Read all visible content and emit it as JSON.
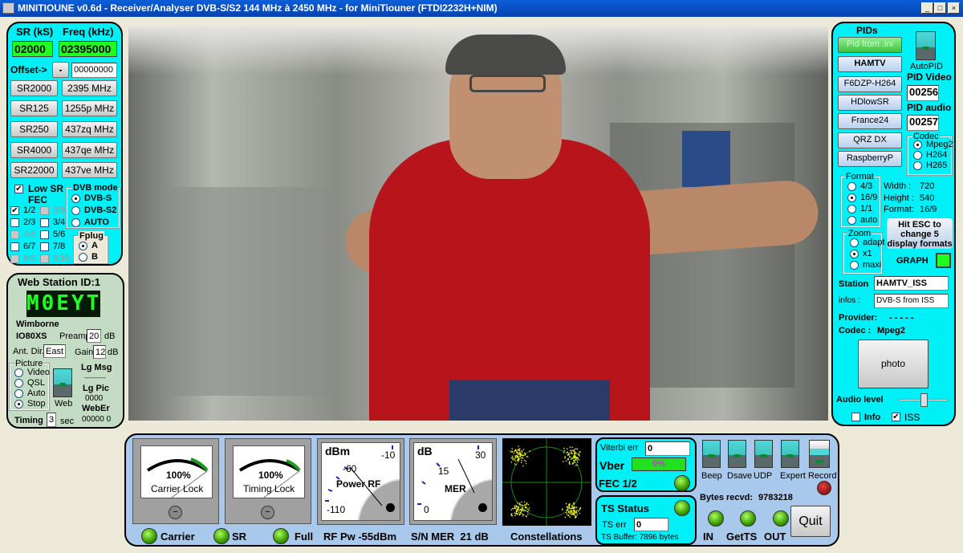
{
  "window": {
    "title": "MINITIOUNE v0.6d - Receiver/Analyser DVB-S/S2 144 MHz à 2450 MHz - for MiniTiouner (FTDI2232H+NIM)",
    "min": "_",
    "max": "□",
    "close": "×"
  },
  "tuning": {
    "sr_label": "SR (kS)",
    "freq_label": "Freq (kHz)",
    "sr_value": "02000",
    "freq_value": "02395000",
    "offset_label": "Offset->",
    "offset_sign": "-",
    "offset_value": "00000000",
    "sr_buttons": [
      "SR2000",
      "SR125",
      "SR250",
      "SR4000",
      "SR22000"
    ],
    "freq_buttons": [
      "2395 MHz",
      "1255p MHz",
      "437zq MHz",
      "437qe MHz",
      "437ve MHz"
    ],
    "low_sr": {
      "label": "Low SR",
      "checked": true
    },
    "fec_label": "FEC",
    "fec": [
      {
        "label": "1/2",
        "checked": true,
        "enabled": true
      },
      {
        "label": "3/5",
        "checked": false,
        "enabled": false
      },
      {
        "label": "2/3",
        "checked": false,
        "enabled": true
      },
      {
        "label": "3/4",
        "checked": false,
        "enabled": true
      },
      {
        "label": "4/5",
        "checked": false,
        "enabled": false
      },
      {
        "label": "5/6",
        "checked": false,
        "enabled": true
      },
      {
        "label": "6/7",
        "checked": false,
        "enabled": true
      },
      {
        "label": "7/8",
        "checked": false,
        "enabled": true
      },
      {
        "label": "8/9",
        "checked": false,
        "enabled": false
      },
      {
        "label": "9/10",
        "checked": false,
        "enabled": false
      }
    ],
    "dvb_mode": {
      "label": "DVB mode",
      "options": [
        "DVB-S",
        "DVB-S2",
        "AUTO"
      ],
      "selected": "DVB-S"
    },
    "fplug": {
      "label": "Fplug",
      "options": [
        "A",
        "B"
      ],
      "selected": "A"
    }
  },
  "web": {
    "title": "Web Station ID:1",
    "callsign": "M0EYT",
    "location": "Wimborne",
    "locator": "IO80XS",
    "preamp_label": "Preamp",
    "preamp": "20",
    "db": "dB",
    "ant_label": "Ant. Dir.",
    "ant": "East",
    "gain_label": "Gain",
    "gain": "12",
    "picture": {
      "label": "Picture",
      "options": [
        "Video",
        "QSL",
        "Auto",
        "Stop"
      ],
      "selected": "Stop"
    },
    "web_switch": "Web",
    "lg_msg": "Lg Msg",
    "lg_msg_val": "----------",
    "lg_pic": "Lg Pic",
    "lg_pic_val": "0000",
    "weber": "WebEr",
    "weber_val": "00000 0",
    "timing_label": "Timing",
    "timing": "3",
    "sec": "sec"
  },
  "pids": {
    "title": "PIDs",
    "buttons": [
      "Pid from .ini",
      "HAMTV",
      "F6DZP-H264",
      "HDlowSR",
      "France24",
      "QRZ DX",
      "RaspberryP"
    ],
    "autopid": "AutoPID",
    "pid_video_label": "PID Video",
    "pid_video": "00256",
    "pid_audio_label": "PID audio",
    "pid_audio": "00257",
    "codec": {
      "label": "Codec",
      "options": [
        "Mpeg2",
        "H264",
        "H265"
      ],
      "selected": "Mpeg2"
    },
    "format": {
      "label": "Format",
      "options": [
        "4/3",
        "16/9",
        "1/1",
        "auto"
      ],
      "selected": "16/9"
    },
    "info": {
      "width_label": "Width :",
      "width": "720",
      "height_label": "Height :",
      "height": "540",
      "format_label": "Format:",
      "format": "16/9"
    },
    "esc_hint": [
      "Hit ESC to",
      "change  5",
      "display formats"
    ],
    "zoom": {
      "label": "Zoom",
      "options": [
        "adapt",
        "x1",
        "maxi"
      ],
      "selected": "x1"
    },
    "graph": "GRAPH",
    "station_label": "Station",
    "station": "HAMTV_ISS",
    "infos_label": "infos :",
    "infos": "DVB-S from ISS",
    "provider_label": "Provider:",
    "provider": "- - - - -",
    "codec_label": "Codec :",
    "codec_val": "Mpeg2",
    "photo": "photo",
    "audio_label": "Audio level",
    "audio_level": 0.5,
    "info_chk": {
      "label": "Info",
      "checked": false
    },
    "iss_chk": {
      "label": "ISS",
      "checked": true
    }
  },
  "status": {
    "carrier_lock": {
      "value": "100%",
      "label": "Carrier Lock"
    },
    "timing_lock": {
      "value": "100%",
      "label": "Timing Lock"
    },
    "power": {
      "unit": "dBm",
      "ticks": [
        "-10",
        "-60",
        "-110"
      ],
      "label": "Power RF"
    },
    "mer": {
      "unit": "dB",
      "ticks": [
        "30",
        "15",
        "0"
      ],
      "label": "MER"
    },
    "carrier": "Carrier",
    "sr": "SR",
    "full": "Full",
    "rf_pw": "RF Pw -55dBm",
    "sn_mer": "S/N MER  21 dB",
    "constellations": "Constellations",
    "viterbi_label": "Viterbi err",
    "viterbi": "0",
    "vber_label": "Vber",
    "vber": "0%",
    "fec": "FEC 1/2",
    "ts_status": "TS Status",
    "ts_err_label": "TS err",
    "ts_err": "0",
    "ts_buffer": "TS Buffer: 7896 bytes",
    "switches": [
      "Beep",
      "Dsave",
      "UDP",
      "Expert",
      "Record"
    ],
    "bytes_label": "Bytes recvd:",
    "bytes": "9783218",
    "leds": [
      "IN",
      "GetTS",
      "OUT"
    ],
    "quit": "Quit"
  },
  "colors": {
    "panel_cyan": "#00f0f8",
    "panel_blue": "#a8c8ec",
    "panel_green": "#c4dcc4",
    "led_green": "#3a9a00",
    "lcd_text": "#20ff20"
  }
}
